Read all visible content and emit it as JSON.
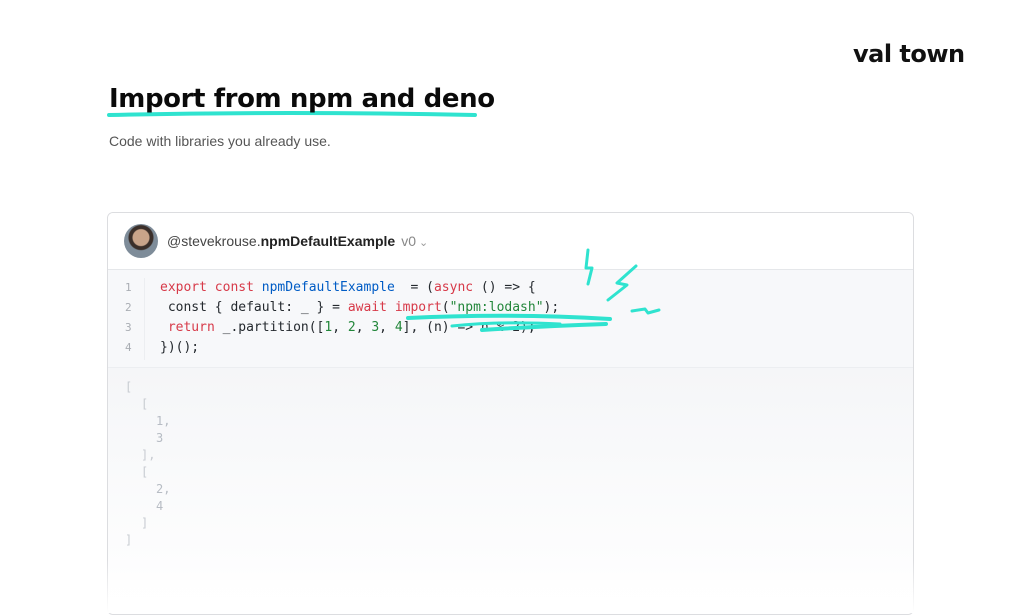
{
  "brand": "val town",
  "page": {
    "title": "Import from npm and deno",
    "subtitle": "Code with libraries you already use."
  },
  "val": {
    "handle": "@stevekrouse.",
    "name": "npmDefaultExample",
    "version": "v0"
  },
  "code": {
    "line_numbers": [
      "1",
      "2",
      "3",
      "4"
    ],
    "lines": [
      [
        [
          "kw",
          "export "
        ],
        [
          "kw",
          "const "
        ],
        [
          "fn",
          "npmDefaultExample"
        ],
        [
          "",
          "  = ("
        ],
        [
          "kw",
          "async"
        ],
        [
          "",
          " () => {"
        ]
      ],
      [
        [
          "",
          " const { default: _ } = "
        ],
        [
          "kw",
          "await "
        ],
        [
          "kw",
          "import"
        ],
        [
          "",
          "("
        ],
        [
          "str",
          "\"npm:lodash\""
        ],
        [
          "",
          ");"
        ]
      ],
      [
        [
          "kw",
          " return "
        ],
        [
          "",
          "_.partition(["
        ],
        [
          "num",
          "1"
        ],
        [
          "",
          ", "
        ],
        [
          "num",
          "2"
        ],
        [
          "",
          ", "
        ],
        [
          "num",
          "3"
        ],
        [
          "",
          ", "
        ],
        [
          "num",
          "4"
        ],
        [
          "",
          "], (n) => n % 2);"
        ]
      ],
      [
        [
          "",
          "})();"
        ]
      ]
    ]
  },
  "output": [
    "[",
    "[",
    "1,",
    "3",
    "],",
    "[",
    "2,",
    "4",
    "]",
    "]"
  ],
  "colors": {
    "highlight": "#2fe3cf",
    "keyword": "#d73a49",
    "string": "#22863a"
  }
}
